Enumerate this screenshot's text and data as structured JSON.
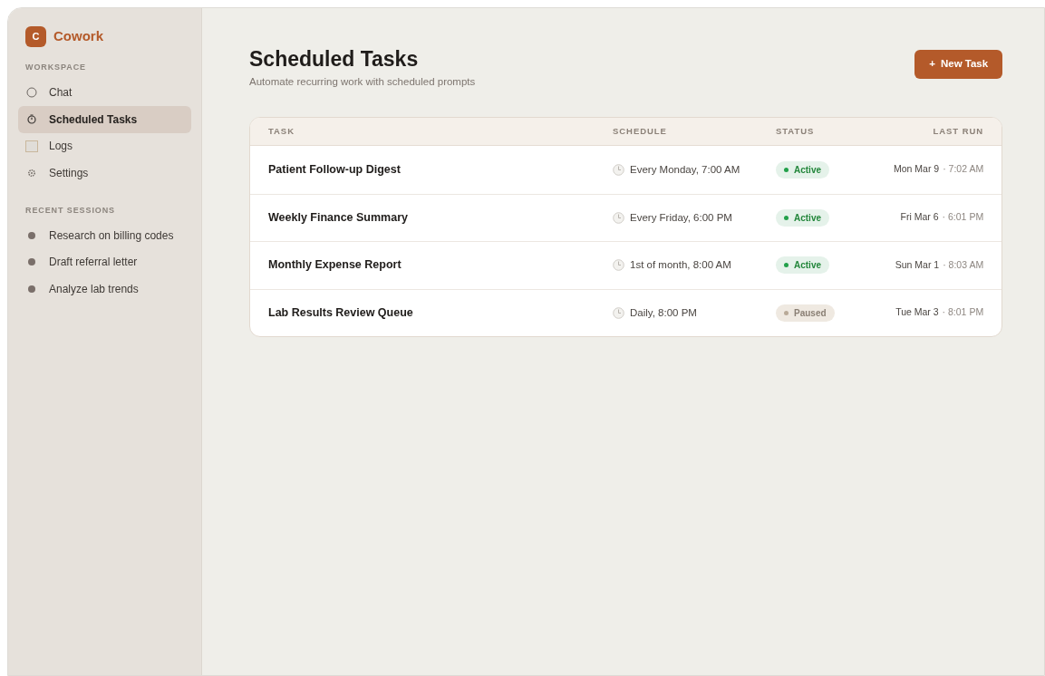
{
  "brand": {
    "letter": "C",
    "name": "Cowork"
  },
  "sidebar": {
    "sections": [
      {
        "heading": "WORKSPACE",
        "items": [
          {
            "label": "Chat",
            "selected": false
          },
          {
            "label": "Scheduled Tasks",
            "selected": true
          },
          {
            "label": "Logs",
            "selected": false
          },
          {
            "label": "Settings",
            "selected": false
          }
        ]
      },
      {
        "heading": "RECENT SESSIONS",
        "items": [
          {
            "label": "Research on billing codes",
            "selected": false
          },
          {
            "label": "Draft referral letter",
            "selected": false
          },
          {
            "label": "Analyze lab trends",
            "selected": false
          }
        ]
      }
    ]
  },
  "header": {
    "title": "Scheduled Tasks",
    "subtitle": "Automate recurring work with scheduled prompts",
    "button": {
      "icon": "+",
      "label": "New Task"
    }
  },
  "table": {
    "columns": [
      "TASK",
      "SCHEDULE",
      "STATUS",
      "LAST RUN"
    ],
    "rows": [
      {
        "task": "Patient Follow-up Digest",
        "schedule": "Every Monday, 7:00 AM",
        "status": {
          "label": "Active",
          "kind": "active"
        },
        "last_run": {
          "date": "Mon Mar 9",
          "time": "· 7:02 AM"
        }
      },
      {
        "task": "Weekly Finance Summary",
        "schedule": "Every Friday, 6:00 PM",
        "status": {
          "label": "Active",
          "kind": "active"
        },
        "last_run": {
          "date": "Fri Mar 6",
          "time": "· 6:01 PM"
        }
      },
      {
        "task": "Monthly Expense Report",
        "schedule": "1st of month, 8:00 AM",
        "status": {
          "label": "Active",
          "kind": "active"
        },
        "last_run": {
          "date": "Sun Mar 1",
          "time": "· 8:03 AM"
        }
      },
      {
        "task": "Lab Results Review Queue",
        "schedule": "Daily, 8:00 PM",
        "status": {
          "label": "Paused",
          "kind": "paused"
        },
        "last_run": {
          "date": "Tue Mar 3",
          "time": "· 8:01 PM"
        }
      }
    ]
  }
}
